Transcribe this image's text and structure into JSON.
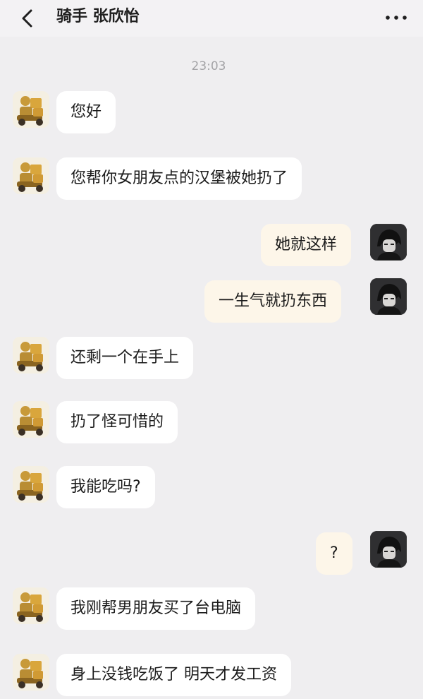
{
  "header": {
    "title": "骑手 张欣怡",
    "back_icon": "chevron-left-icon",
    "more_icon": "more-horizontal-icon"
  },
  "timestamp": "23:03",
  "messages": [
    {
      "side": "in",
      "text": "您好"
    },
    {
      "side": "in",
      "text": "您帮你女朋友点的汉堡被她扔了"
    },
    {
      "side": "out",
      "text": "她就这样"
    },
    {
      "side": "out",
      "text": "一生气就扔东西"
    },
    {
      "side": "in",
      "text": "还剩一个在手上"
    },
    {
      "side": "in",
      "text": "扔了怪可惜的"
    },
    {
      "side": "in",
      "text": "我能吃吗?"
    },
    {
      "side": "out",
      "text": "?"
    },
    {
      "side": "in",
      "text": "我刚帮男朋友买了台电脑"
    },
    {
      "side": "in",
      "text": "身上没钱吃饭了 明天才发工资"
    }
  ],
  "colors": {
    "background": "#efeef0",
    "incoming_bubble": "#ffffff",
    "outgoing_bubble": "#fdf6e9",
    "timestamp_text": "#a3a3a6"
  }
}
